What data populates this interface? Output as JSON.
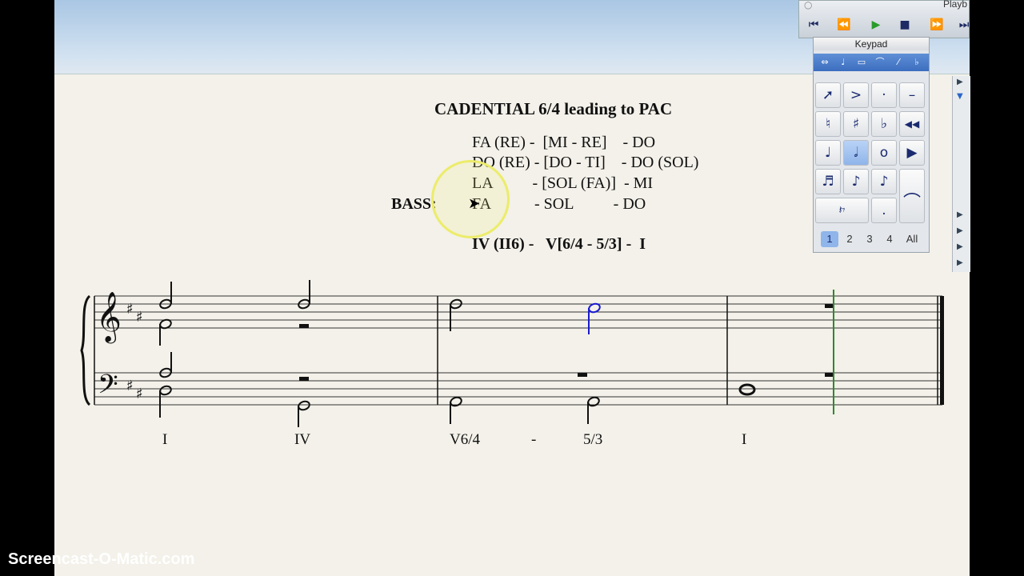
{
  "window": {
    "watermark": "Screencast-O-Matic.com"
  },
  "sheet": {
    "title": "CADENTIAL 6/4 leading to PAC",
    "voice_lines": [
      "FA (RE) -  [MI - RE]    - DO",
      "DO (RE) - [DO - TI]    - DO (SOL)",
      "LA          - [SOL (FA)]  - MI",
      "FA           - SOL          - DO"
    ],
    "bass_label": "BASS:",
    "progression": "IV (II6) -   V[6/4 - 5/3] -  I",
    "roman_numerals": [
      "I",
      "IV",
      "V6/4",
      "-",
      "5/3",
      "I"
    ]
  },
  "playback": {
    "title": "Playb",
    "buttons": [
      {
        "icon": "rewind-to-start-icon",
        "glyph": "⏮"
      },
      {
        "icon": "rewind-icon",
        "glyph": "⏪"
      },
      {
        "icon": "play-icon",
        "glyph": "▶"
      },
      {
        "icon": "stop-icon",
        "glyph": "■"
      },
      {
        "icon": "fast-forward-icon",
        "glyph": "⏩"
      },
      {
        "icon": "forward-to-end-icon",
        "glyph": "⏭"
      }
    ]
  },
  "keypad": {
    "title": "Keypad",
    "keys": [
      {
        "icon": "select-arrow-icon",
        "glyph": "➚"
      },
      {
        "icon": "accent-icon",
        "glyph": ">"
      },
      {
        "icon": "staccato-icon",
        "glyph": "·"
      },
      {
        "icon": "tenuto-icon",
        "glyph": "–"
      },
      {
        "icon": "natural-icon",
        "glyph": "♮"
      },
      {
        "icon": "sharp-icon",
        "glyph": "♯"
      },
      {
        "icon": "flat-icon",
        "glyph": "♭"
      },
      {
        "icon": "rewind-icon",
        "glyph": "◀◀"
      },
      {
        "icon": "quarter-note-icon",
        "glyph": "♩"
      },
      {
        "icon": "half-note-icon",
        "glyph": "𝅗𝅥"
      },
      {
        "icon": "whole-note-icon",
        "glyph": "o"
      },
      {
        "icon": "play-icon",
        "glyph": "▶"
      },
      {
        "icon": "sixteenth-note-icon",
        "glyph": "♬"
      },
      {
        "icon": "eighth-note-icon",
        "glyph": "♪"
      },
      {
        "icon": "eighth-note-flag-icon",
        "glyph": "♪"
      },
      {
        "icon": "blank-key-icon",
        "glyph": ""
      },
      {
        "icon": "rest-icon",
        "glyph": "𝄽𝄾"
      },
      {
        "icon": "dot-icon",
        "glyph": "."
      },
      {
        "icon": "tie-icon",
        "glyph": "⌒"
      }
    ],
    "layers": [
      "1",
      "2",
      "3",
      "4",
      "All"
    ],
    "selected_layer": "1"
  },
  "colors": {
    "selected_note": "#1a1ad0",
    "playback_line": "#2c8a2c",
    "highlight": "#ecec6a"
  }
}
